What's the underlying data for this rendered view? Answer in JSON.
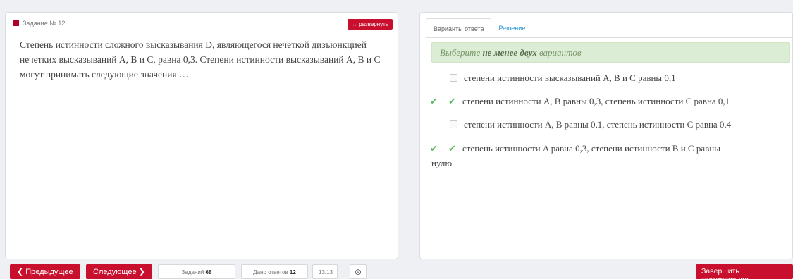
{
  "question": {
    "header": "Задание № 12",
    "expand_label": "↔ развернуть",
    "text": "Степень истинности сложного высказывания D, являющегося нечеткой дизъюнкцией нечетких высказываний A, B и C, равна 0,3. Степени истинности высказываний A, B и C могут принимать следующие значения …"
  },
  "tabs": [
    "Варианты ответа",
    "Решение"
  ],
  "hint": {
    "prefix": "Выберите ",
    "emphasis": "не менее двух",
    "suffix": " вариантов"
  },
  "options": [
    {
      "text": "степени истинности высказываний A, B и C равны 0,1",
      "checked": false,
      "correct": false
    },
    {
      "text": "степени истинности A, B равны 0,3, степень истинности C равна 0,1",
      "checked": true,
      "correct": true
    },
    {
      "text": "степени истинности A, B равны 0,1, степень истинности C равна 0,4",
      "checked": false,
      "correct": false
    },
    {
      "text": "степень истинности A равна 0,3, степени истинности B и C равны",
      "text_cont": "нулю",
      "checked": true,
      "correct": true
    }
  ],
  "footer": {
    "prev_label": "❮ Предыдущее",
    "next_label": "Следующее ❯",
    "tasks_label": "Заданий",
    "tasks_count": "68",
    "answered_label": "Дано ответов",
    "answered_count": "12",
    "time": "13:13",
    "finish_label": "Завершить тестирование"
  },
  "colors": {
    "accent_red": "#c8102e",
    "check_green": "#5cb85c",
    "hint_bg": "#dbeed5",
    "link_blue": "#1a8fce"
  },
  "icons": {
    "check": "check-icon",
    "settings": "circle-icon"
  }
}
